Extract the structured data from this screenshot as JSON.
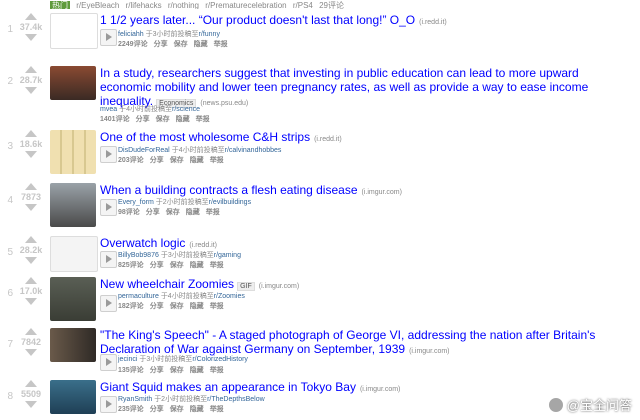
{
  "top_strip": {
    "tag": "热门",
    "items": [
      "r/EyeBleach",
      "r/lifehacks",
      "r/nothing",
      "r/Prematurecelebration",
      "r/PS4",
      "29评论"
    ]
  },
  "post_actions": {
    "share": "分享",
    "save": "保存",
    "hide": "隐藏",
    "report": "举报"
  },
  "posts": [
    {
      "rank": "1",
      "score": "37.4k",
      "title": "1 1/2 years later... “Our product doesn't last that long!” O_O",
      "domain": "(i.redd.it)",
      "flair": "",
      "author": "feliciahh",
      "submitted": "于3小时前投稿至",
      "subreddit": "r/funny",
      "comments": "2249评论",
      "thumb_color": "#ffffff"
    },
    {
      "rank": "2",
      "score": "28.7k",
      "title": "In a study, researchers suggest that investing in public education can lead to more upward economic mobility and lower teen pregnancy rates, as well as provide a way to ease income inequality.",
      "domain": "(news.psu.edu)",
      "flair": "Economics",
      "author": "mvea",
      "submitted": "于4小时前投稿至",
      "subreddit": "r/science",
      "comments": "1401评论",
      "thumb_color": "#7a3a2a"
    },
    {
      "rank": "3",
      "score": "18.6k",
      "title": "One of the most wholesome C&H strips",
      "domain": "(i.redd.it)",
      "flair": "",
      "author": "DisDudeForReal",
      "submitted": "于4小时前投稿至",
      "subreddit": "r/calvinandhobbes",
      "comments": "203评论",
      "thumb_color": "#e8d8a8"
    },
    {
      "rank": "4",
      "score": "7873",
      "title": "When a building contracts a flesh eating disease",
      "domain": "(i.imgur.com)",
      "flair": "",
      "author": "Every_form",
      "submitted": "于2小时前投稿至",
      "subreddit": "r/evilbuildings",
      "comments": "98评论",
      "thumb_color": "#6b6b6b"
    },
    {
      "rank": "5",
      "score": "28.2k",
      "title": "Overwatch logic",
      "domain": "(i.redd.it)",
      "flair": "",
      "author": "BillyBob9876",
      "submitted": "于3小时前投稿至",
      "subreddit": "r/gaming",
      "comments": "825评论",
      "thumb_color": "#f2f2f2"
    },
    {
      "rank": "6",
      "score": "17.0k",
      "title": "New wheelchair Zoomies",
      "domain": "(i.imgur.com)",
      "flair": "GIF",
      "author": "permaculture",
      "submitted": "于4小时前投稿至",
      "subreddit": "r/Zoomies",
      "comments": "182评论",
      "thumb_color": "#4a4f45"
    },
    {
      "rank": "7",
      "score": "7842",
      "title": "\"The King's Speech\" - A staged photograph of George VI, addressing the nation after Britain's Declaration of War against Germany on September, 1939",
      "domain": "(i.imgur.com)",
      "flair": "",
      "author": "jecinci",
      "submitted": "于3小时前投稿至",
      "subreddit": "r/ColorizedHistory",
      "comments": "135评论",
      "thumb_color": "#5b4b3b"
    },
    {
      "rank": "8",
      "score": "5509",
      "title": "Giant Squid makes an appearance in Tokyo Bay",
      "domain": "(i.imgur.com)",
      "flair": "",
      "author": "RyanSmith",
      "submitted": "于2小时前投稿至",
      "subreddit": "r/TheDepthsBelow",
      "comments": "235评论",
      "thumb_color": "#2f5f7a"
    }
  ],
  "watermark": {
    "text": "@宝全问答"
  }
}
